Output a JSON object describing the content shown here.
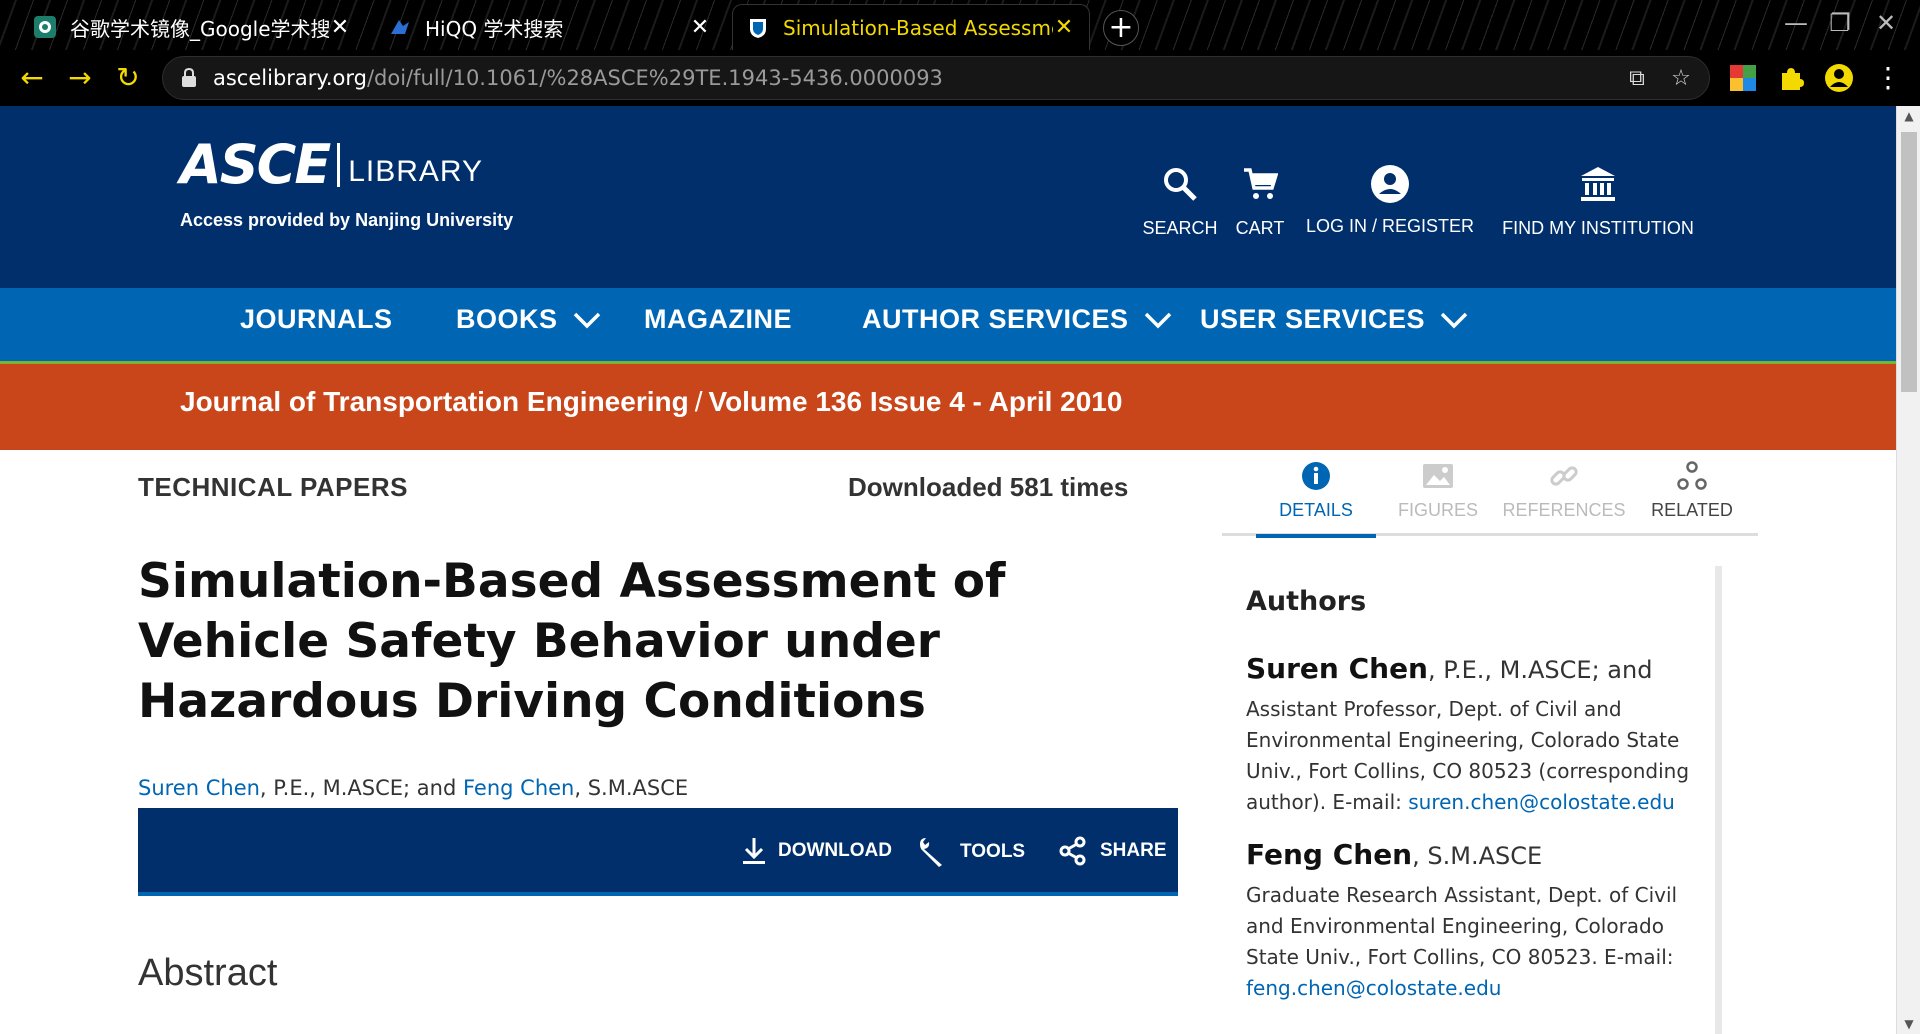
{
  "browser": {
    "tabs": [
      {
        "title": "谷歌学术镜像_Google学术搜索导",
        "active": false
      },
      {
        "title": "HiQQ 学术搜索",
        "active": false
      },
      {
        "title": "Simulation-Based Assessment",
        "active": true
      }
    ],
    "url_host": "ascelibrary.org",
    "url_path": "/doi/full/10.1061/%28ASCE%29TE.1943-5436.0000093"
  },
  "header": {
    "logo_main": "ASCE",
    "logo_sub": "LIBRARY",
    "access_text": "Access provided by  Nanjing University",
    "nav": {
      "search": "SEARCH",
      "cart": "CART",
      "login": "LOG IN / REGISTER",
      "institution": "FIND MY INSTITUTION"
    }
  },
  "main_nav": [
    "JOURNALS",
    "BOOKS",
    "MAGAZINE",
    "AUTHOR SERVICES",
    "USER SERVICES"
  ],
  "journal_bar": {
    "journal": "Journal of Transportation Engineering",
    "separator": "/",
    "issue": "Volume 136 Issue 4 - April 2010"
  },
  "article": {
    "section": "TECHNICAL PAPERS",
    "downloads": "Downloaded 581 times",
    "title": "Simulation-Based Assessment of Vehicle Safety Behavior under Hazardous Driving Conditions",
    "author1": "Suren Chen",
    "author1_suffix": ", P.E., M.ASCE; and ",
    "author2": "Feng Chen",
    "author2_suffix": ", S.M.ASCE",
    "actions": {
      "download": "DOWNLOAD",
      "tools": "TOOLS",
      "share": "SHARE"
    },
    "abstract_heading": "Abstract"
  },
  "side": {
    "tabs": [
      "DETAILS",
      "FIGURES",
      "REFERENCES",
      "RELATED"
    ],
    "authors_heading": "Authors",
    "a1_name": "Suren Chen",
    "a1_suffix": ", P.E., M.ASCE; and",
    "a1_aff": "Assistant Professor, Dept. of Civil and Environmental Engineering, Colorado State Univ., Fort Collins, CO 80523 (corresponding author). E-mail: ",
    "a1_email": "suren.chen@colostate.edu",
    "a2_name": "Feng Chen",
    "a2_suffix": ", S.M.ASCE",
    "a2_aff": "Graduate Research Assistant, Dept. of Civil and Environmental Engineering, Colorado State Univ., Fort Collins, CO 80523. E-mail: ",
    "a2_email": "feng.chen@colostate.edu"
  },
  "colors": {
    "header": "#002f6c",
    "nav": "#0066b3",
    "journal_bar": "#c9451a",
    "link": "#0066b3"
  }
}
